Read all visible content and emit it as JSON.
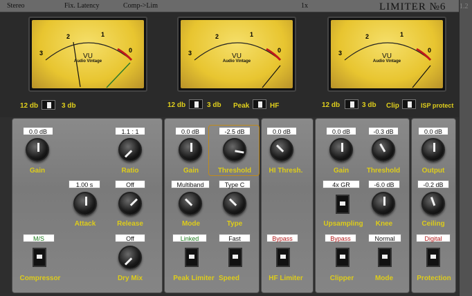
{
  "topbar": {
    "stereo": "Stereo",
    "latency": "Fix. Latency",
    "mode": "Comp->Lim",
    "oversample": "1x",
    "brand": "LIMITER №6",
    "version": "1.2"
  },
  "meters": [
    {
      "vu": "VU",
      "sub": "Audio Vintage",
      "scale": [
        "3",
        "2",
        "1",
        "0"
      ]
    },
    {
      "vu": "VU",
      "sub": "Audio Vintage",
      "scale": [
        "3",
        "2",
        "1",
        "0"
      ]
    },
    {
      "vu": "VU",
      "sub": "Audio Vintage",
      "scale": [
        "3",
        "2",
        "1",
        "0"
      ]
    }
  ],
  "meter_controls": {
    "m1": {
      "left": "12 db",
      "right": "3 db"
    },
    "m2": {
      "left": "12 db",
      "right": "3 db",
      "peak": "Peak",
      "hf": "HF"
    },
    "m3": {
      "left": "12 db",
      "right": "3 db",
      "clip": "Clip",
      "isp": "ISP protect"
    }
  },
  "compressor": {
    "gain": {
      "value": "0.0 dB",
      "label": "Gain"
    },
    "ratio": {
      "value": "1.1 : 1",
      "label": "Ratio"
    },
    "attack": {
      "value": "1.00 s",
      "label": "Attack"
    },
    "release": {
      "value": "Off",
      "label": "Release"
    },
    "mode": {
      "value": "M/S",
      "label": "Compressor"
    },
    "drymix": {
      "value": "Off",
      "label": "Dry Mix"
    }
  },
  "peak_limiter": {
    "gain": {
      "value": "0.0 dB",
      "label": "Gain"
    },
    "threshold": {
      "value": "-2.5 dB",
      "label": "Threshold"
    },
    "mode": {
      "value": "Multiband",
      "label": "Mode"
    },
    "type": {
      "value": "Type C",
      "label": "Type"
    },
    "link": {
      "value": "Linked",
      "label": "Peak Limiter"
    },
    "speed": {
      "value": "Fast",
      "label": "Speed"
    }
  },
  "hf_limiter": {
    "thresh": {
      "value": "0.0 dB",
      "label": "HI Thresh."
    },
    "bypass": {
      "value": "Bypass",
      "label": "HF Limiter"
    }
  },
  "clipper": {
    "gain": {
      "value": "0.0 dB",
      "label": "Gain"
    },
    "threshold": {
      "value": "-0.3 dB",
      "label": "Threshold"
    },
    "upsampling": {
      "value": "4x GR",
      "label": "Upsampling"
    },
    "knee": {
      "value": "-6.0 dB",
      "label": "Knee"
    },
    "bypass": {
      "value": "Bypass",
      "label": "Clipper"
    },
    "mode": {
      "value": "Normal",
      "label": "Mode"
    }
  },
  "protection": {
    "output": {
      "value": "0.0 dB",
      "label": "Output"
    },
    "ceiling": {
      "value": "-0.2 dB",
      "label": "Ceiling"
    },
    "mode": {
      "value": "Digital",
      "label": "Protection"
    }
  }
}
